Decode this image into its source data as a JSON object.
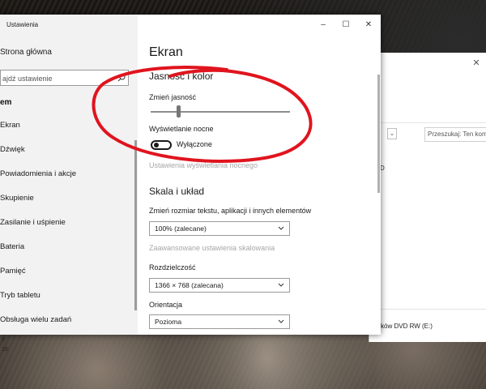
{
  "settings": {
    "title": "Ustawienia",
    "home": "Strona główna",
    "search_placeholder": "ajdź ustawienie",
    "section": "em",
    "nav": [
      "Ekran",
      "Dźwięk",
      "Powiadomienia i akcje",
      "Skupienie",
      "Zasilanie i uśpienie",
      "Bateria",
      "Pamięć",
      "Tryb tabletu",
      "Obsługa wielu zadań"
    ],
    "bottom_fragments": [
      "5",
      "10"
    ]
  },
  "content": {
    "page_title": "Ekran",
    "brightness_heading": "Jasność i kolor",
    "brightness_label": "Zmień jasność",
    "brightness_value": 0.2,
    "night_label": "Wyświetlanie nocne",
    "night_state": "Wyłączone",
    "night_settings_link": "Ustawienia wyświetlania nocnego",
    "scale_heading": "Skala i układ",
    "scale_label": "Zmień rozmiar tekstu, aplikacji i innych elementów",
    "scale_value": "100% (zalecane)",
    "advanced_scale_link": "Zaawansowane ustawienia skalowania",
    "resolution_label": "Rozdzielczość",
    "resolution_value": "1366 × 768 (zalecana)",
    "orientation_label": "Orientacja",
    "orientation_value": "Pozioma"
  },
  "explorer": {
    "search_placeholder": "Przeszukaj: Ten komp",
    "drive_letter": "D",
    "dvd_label": "sków DVD RW (E:)"
  },
  "colors": {
    "annotation": "#e0141e",
    "sidebar_bg": "#f2f2f2",
    "link_gray": "#a7a7a7"
  }
}
